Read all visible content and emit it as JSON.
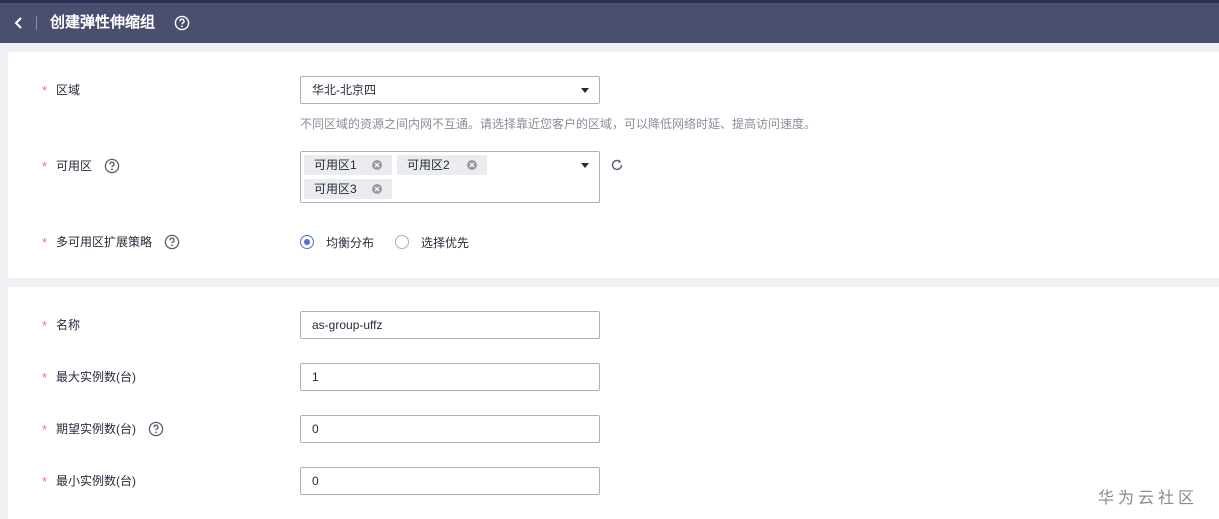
{
  "header": {
    "title": "创建弹性伸缩组"
  },
  "region": {
    "label": "区域",
    "value": "华北-北京四",
    "hint": "不同区域的资源之间内网不互通。请选择靠近您客户的区域，可以降低网络时延、提高访问速度。"
  },
  "az": {
    "label": "可用区",
    "tags": [
      "可用区1",
      "可用区2",
      "可用区3"
    ]
  },
  "strategy": {
    "label": "多可用区扩展策略",
    "options": [
      "均衡分布",
      "选择优先"
    ],
    "selected": 0
  },
  "name": {
    "label": "名称",
    "value": "as-group-uffz"
  },
  "max": {
    "label": "最大实例数(台)",
    "value": "1"
  },
  "desired": {
    "label": "期望实例数(台)",
    "value": "0"
  },
  "min": {
    "label": "最小实例数(台)",
    "value": "0"
  },
  "watermark": "华为云社区",
  "colors": {
    "header_bg": "#4b4f6e",
    "accent": "#526ecc",
    "required_star": "#f66f6a"
  },
  "icons": {
    "back": "chevron-left-icon",
    "help": "question-circle-icon",
    "refresh": "refresh-icon",
    "tag_close": "close-circle-icon",
    "dropdown": "caret-down-icon"
  }
}
